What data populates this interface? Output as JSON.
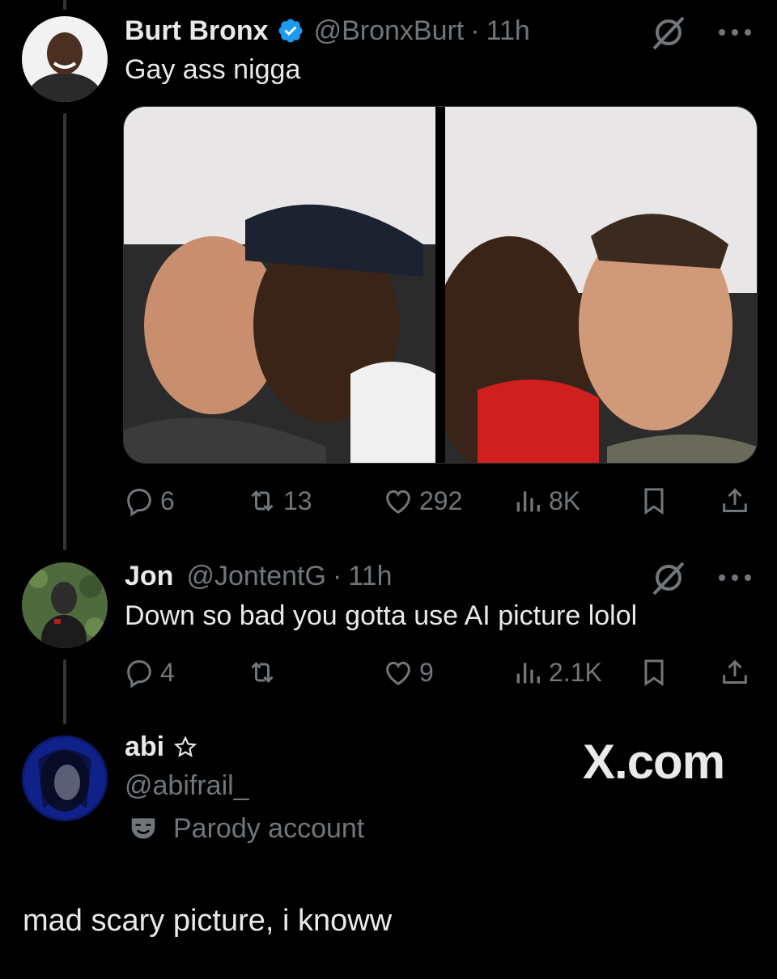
{
  "tweet1": {
    "display_name": "Burt Bronx",
    "handle": "@BronxBurt",
    "separator": "·",
    "time": "11h",
    "text": "Gay ass nigga",
    "verified": true,
    "media_count": 2,
    "stats": {
      "replies": "6",
      "reposts": "13",
      "likes": "292",
      "views": "8K"
    }
  },
  "tweet2": {
    "display_name": "Jon",
    "handle": "@JontentG",
    "separator": "·",
    "time": "11h",
    "text": "Down so bad you gotta use AI picture lolol",
    "stats": {
      "replies": "4",
      "reposts": "",
      "likes": "9",
      "views": "2.1K"
    }
  },
  "author3": {
    "display_name": "abi",
    "handle": "@abifrail_",
    "label": "Parody account"
  },
  "watermark": "X.com",
  "body_text": "mad scary picture, i knoww",
  "colors": {
    "background": "#000000",
    "text_primary": "#e7e9ea",
    "text_secondary": "#71767b",
    "verified_blue": "#1d9bf0",
    "thread_line": "#333639"
  },
  "icons": [
    "verified-badge-icon",
    "grok-icon",
    "more-icon",
    "reply-icon",
    "repost-icon",
    "like-icon",
    "views-icon",
    "bookmark-icon",
    "share-icon",
    "star-outline-icon",
    "parody-mask-icon"
  ]
}
